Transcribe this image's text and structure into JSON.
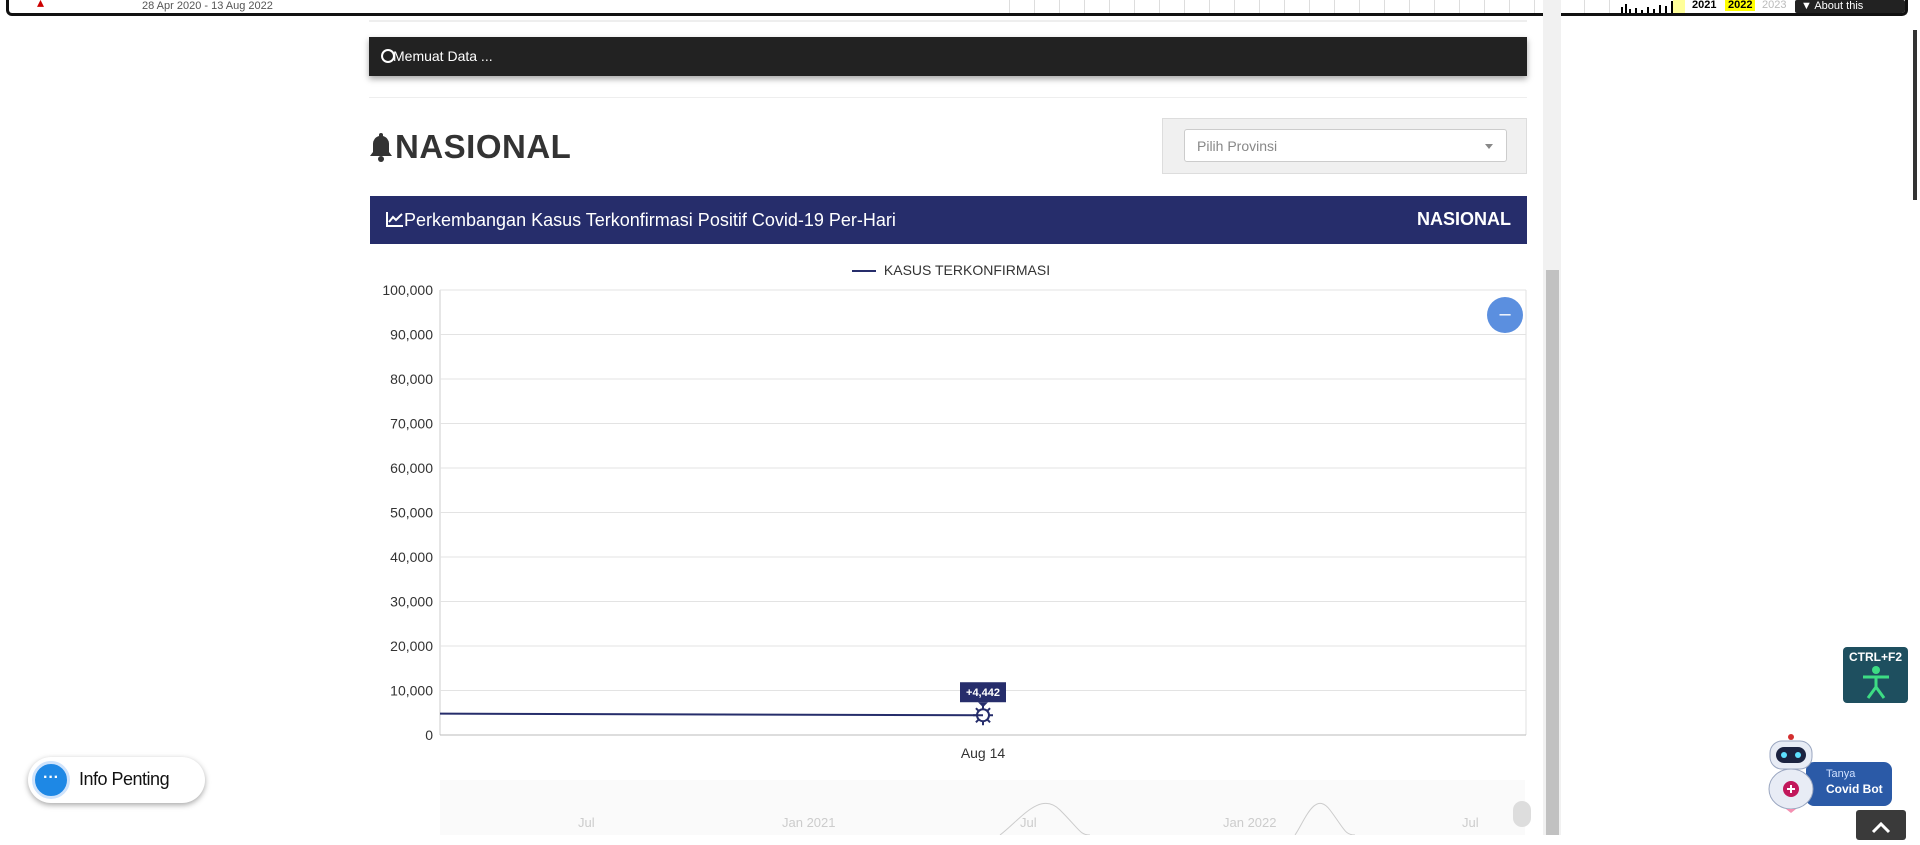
{
  "wayback": {
    "date_range": "28 Apr 2020 - 13 Aug 2022",
    "years": [
      "2021",
      "2022",
      "2023"
    ],
    "about_label": "▼ About this capture"
  },
  "loading": {
    "text": "Memuat Data ..."
  },
  "header": {
    "title": "NASIONAL"
  },
  "province_select": {
    "placeholder": "Pilih Provinsi"
  },
  "chart_panel": {
    "title": "Perkembangan Kasus Terkonfirmasi Positif Covid-19 Per-Hari",
    "region": "NASIONAL",
    "zoom_label": "–"
  },
  "chart_data": {
    "type": "line",
    "title": "",
    "xlabel": "",
    "ylabel": "",
    "ylim": [
      0,
      100000
    ],
    "yticks": [
      0,
      10000,
      20000,
      30000,
      40000,
      50000,
      60000,
      70000,
      80000,
      90000,
      100000
    ],
    "ytick_labels": [
      "0",
      "10,000",
      "20,000",
      "30,000",
      "40,000",
      "50,000",
      "60,000",
      "70,000",
      "80,000",
      "90,000",
      "100,000"
    ],
    "x_labels": [
      "Aug 14"
    ],
    "series": [
      {
        "name": "KASUS TERKONFIRMASI",
        "color": "#262d6b",
        "points": [
          {
            "x": "start",
            "y": 4800
          },
          {
            "x": "Aug 14",
            "y": 4442
          }
        ]
      }
    ],
    "annotation": {
      "x": "Aug 14",
      "label": "+4,442"
    },
    "legend": "top-center",
    "grid": true
  },
  "navigator": {
    "labels": [
      "Jul",
      "Jan 2021",
      "Jul",
      "Jan 2022",
      "Jul"
    ]
  },
  "info": {
    "label": "Info Penting",
    "icon": "chat-dots-icon"
  },
  "accessibility": {
    "shortcut": "CTRL+F2",
    "icon": "accessibility-person-icon"
  },
  "bot": {
    "small": "Tanya",
    "name": "Covid Bot"
  },
  "colors": {
    "brand_navy": "#262d6b",
    "accent_blue": "#5b8fdf",
    "info_blue": "#1e88e5"
  }
}
